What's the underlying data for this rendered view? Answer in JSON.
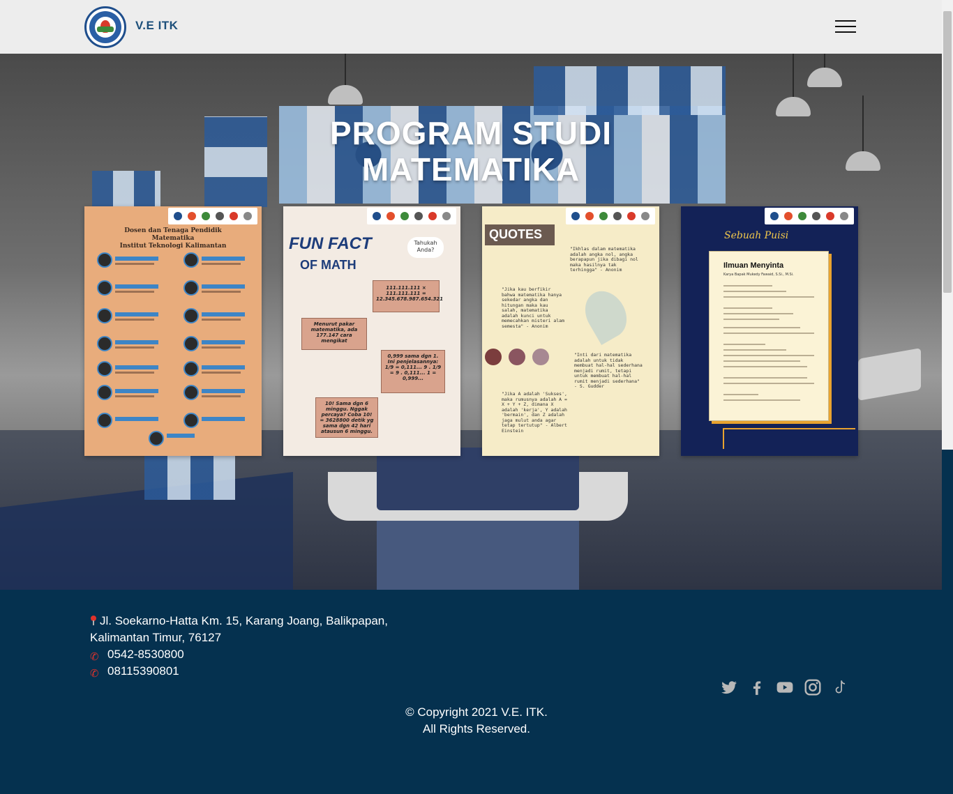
{
  "header": {
    "brand": "V.E ITK"
  },
  "hero": {
    "title_line1": "PROGRAM STUDI",
    "title_line2": "MATEMATIKA"
  },
  "cards": [
    {
      "heading_line1": "Dosen dan Tenaga Pendidik",
      "heading_line2": "Matematika",
      "heading_line3": "Institut Teknologi Kalimantan"
    },
    {
      "title_line1": "FUN FACT",
      "title_line2": "OF MATH",
      "bubble": "Tahukah Anda?",
      "box1": "111.111.111 × 111.111.111 = 12.345.678.987.654.321",
      "box2": "Menurut pakar matematika, ada 177.147 cara mengikat",
      "box3": "0,999 sama dgn 1. Ini penjelasannya: 1/9 = 0,111... 9 . 1/9 = 9 . 0,111... 1 = 0,999...",
      "box4": "10! Sama dgn 6 minggu. Nggak percaya? Coba 10! = 3628800 detik yg sama dgn 42 hari atausun 6 minggu."
    },
    {
      "title": "QUOTES",
      "q1": "\"Ikhlas dalam matematika adalah angka nol, angka berapapun jika dibagi nol maka hasilnya tak terhingga\" - Anonim",
      "q2": "\"Jika kau berfikir bahwa matematika hanya sekedar angka dan hitungan maka kau salah, matematika adalah kunci untuk memecahkan misteri alam semesta\" - Anonim",
      "q3": "\"Inti dari matematika adalah untuk tidak membuat hal-hal sederhana menjadi rumit, tetapi untuk membuat hal-hal rumit menjadi sederhana\" - S. Gudder",
      "q4": "\"Jika A adalah 'Sukses', maka rumusnya adalah A = X + Y + Z, dimana X adalah 'kerja', Y adalah 'bermain', dan Z adalah jaga mulut anda agar tetap tertutup\" - Albert Einstein"
    },
    {
      "script_title": "Sebuah Puisi",
      "poem_title": "Ilmuan Menyinta",
      "author": "Karya Bapak Mukedy Fawaid, S.Si., M.Si."
    }
  ],
  "footer": {
    "address_line1": "Jl. Soekarno-Hatta Km. 15, Karang Joang, Balikpapan,",
    "address_line2": "Kalimantan Timur, 76127",
    "phone1": "0542-8530800",
    "phone2": "08115390801",
    "copyright_line1": "© Copyright 2021 V.E. ITK.",
    "copyright_line2": "All Rights Reserved."
  },
  "social_icons": [
    "twitter-icon",
    "facebook-icon",
    "youtube-icon",
    "instagram-icon",
    "tiktok-icon"
  ],
  "colors": {
    "footer_bg": "#05314f",
    "brand_text": "#1c4f7a",
    "icon_gray": "#b8b8b8"
  }
}
